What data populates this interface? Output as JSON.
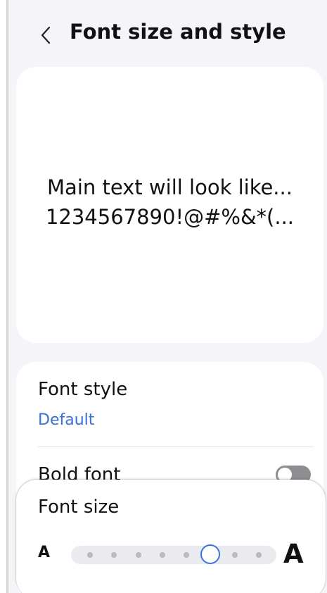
{
  "header": {
    "back_icon": "chevron-left-icon",
    "title": "Font size and style"
  },
  "preview": {
    "line1": "Main text will look like...",
    "line2": "1234567890!@#%&*(..."
  },
  "font_style": {
    "label": "Font style",
    "value": "Default"
  },
  "bold_font": {
    "label": "Bold font",
    "enabled": false
  },
  "font_size": {
    "label": "Font size",
    "small_label": "A",
    "large_label": "A",
    "steps": 8,
    "selected_step": 6
  },
  "colors": {
    "accent": "#3a73e0",
    "link": "#3a6fd6",
    "background": "#f5f4f9",
    "card": "#ffffff",
    "toggle_off": "#8d8d92"
  }
}
